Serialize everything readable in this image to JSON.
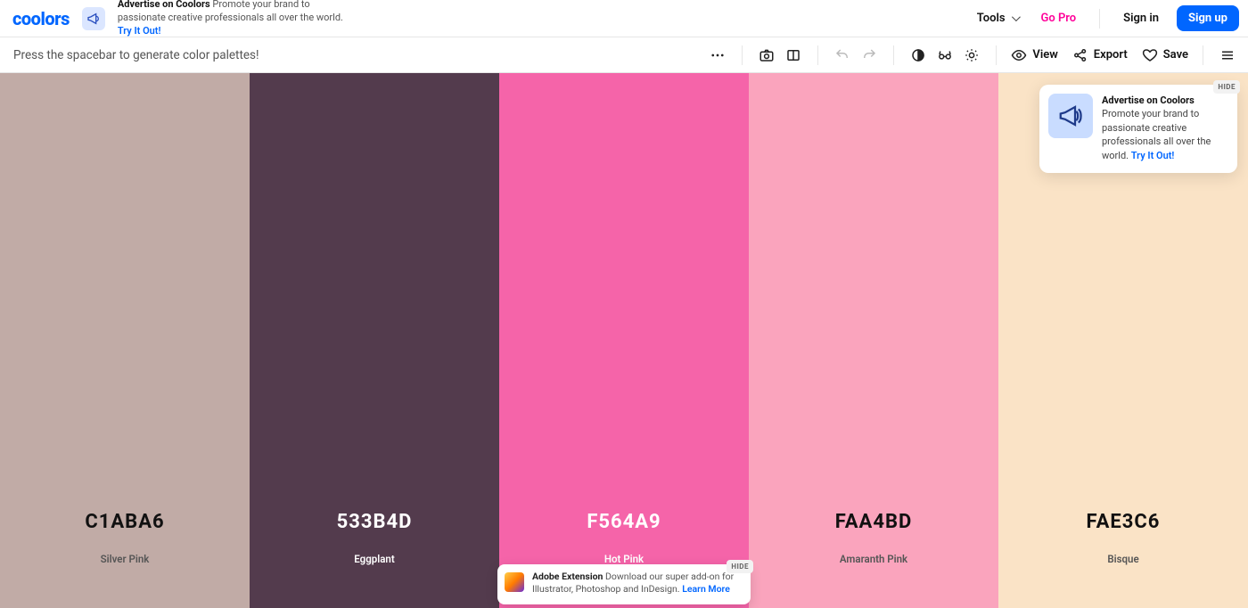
{
  "header": {
    "logo": "coolors",
    "promo": {
      "title": "Advertise on Coolors",
      "body": "Promote your brand to passionate creative professionals all over the world.",
      "link": "Try It Out!"
    },
    "tools_label": "Tools",
    "go_pro": "Go Pro",
    "sign_in": "Sign in",
    "sign_up": "Sign up"
  },
  "toolbar": {
    "hint": "Press the spacebar to generate color palettes!",
    "view_label": "View",
    "export_label": "Export",
    "save_label": "Save"
  },
  "palette": [
    {
      "hex": "C1ABA6",
      "name": "Silver Pink",
      "bg": "#C1ABA6",
      "tone": "light"
    },
    {
      "hex": "533B4D",
      "name": "Eggplant",
      "bg": "#533B4D",
      "tone": "dark"
    },
    {
      "hex": "F564A9",
      "name": "Hot Pink",
      "bg": "#F564A9",
      "tone": "dark"
    },
    {
      "hex": "FAA4BD",
      "name": "Amaranth Pink",
      "bg": "#FAA4BD",
      "tone": "light"
    },
    {
      "hex": "FAE3C6",
      "name": "Bisque",
      "bg": "#FAE3C6",
      "tone": "light"
    }
  ],
  "promo_card": {
    "title": "Advertise on Coolors",
    "body": "Promote your brand to passionate creative professionals all over the world.",
    "link": "Try It Out!",
    "hide": "HIDE"
  },
  "adobe_card": {
    "title": "Adobe Extension",
    "body": "Download our super add-on for Illustrator, Photoshop and InDesign.",
    "link": "Learn More",
    "hide": "HIDE"
  }
}
